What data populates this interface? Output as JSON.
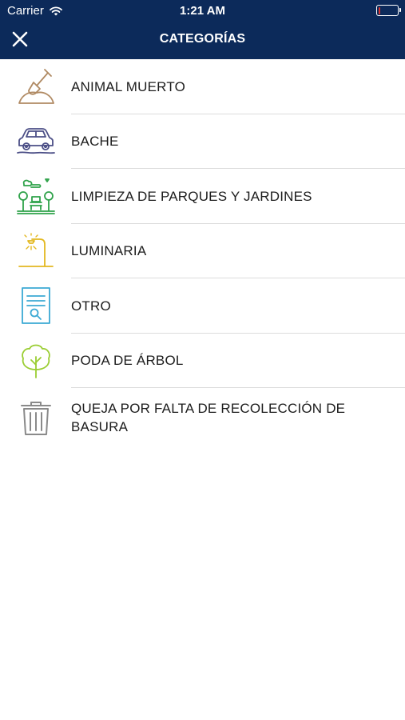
{
  "status_bar": {
    "carrier": "Carrier",
    "time": "1:21 AM",
    "battery_level": 0.08,
    "battery_color": "#e0312b"
  },
  "nav": {
    "title": "CATEGORÍAS",
    "close_icon": "close-icon",
    "background": "#0c2a5a"
  },
  "categories": [
    {
      "label": "ANIMAL MUERTO",
      "icon": "shovel-dirt-icon",
      "color": "#b08a63"
    },
    {
      "label": "BACHE",
      "icon": "car-icon",
      "color": "#4b4e86"
    },
    {
      "label": "LIMPIEZA DE PARQUES Y JARDINES",
      "icon": "park-icon",
      "color": "#2fa24a"
    },
    {
      "label": "LUMINARIA",
      "icon": "street-lamp-icon",
      "color": "#e3b820"
    },
    {
      "label": "OTRO",
      "icon": "document-search-icon",
      "color": "#3ba9d4"
    },
    {
      "label": "PODA DE ÁRBOL",
      "icon": "tree-icon",
      "color": "#9acd32"
    },
    {
      "label": "QUEJA POR FALTA DE RECOLECCIÓN DE BASURA",
      "icon": "trash-can-icon",
      "color": "#8a8a8a"
    }
  ]
}
